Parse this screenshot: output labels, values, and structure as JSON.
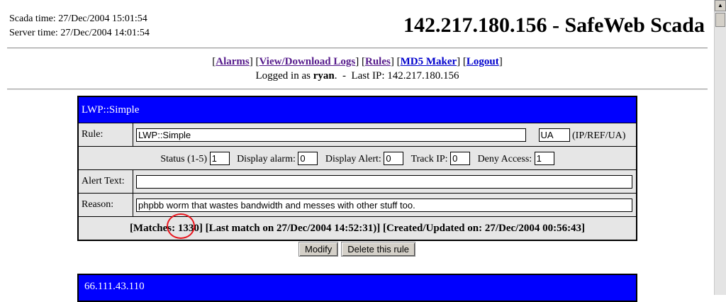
{
  "header": {
    "scada_time_label": "Scada time:",
    "scada_time_value": "27/Dec/2004 15:01:54",
    "server_time_label": "Server time:",
    "server_time_value": "27/Dec/2004 14:01:54",
    "title": "142.217.180.156 - SafeWeb Scada"
  },
  "nav": {
    "alarms": "Alarms",
    "view_logs": "View/Download Logs",
    "rules": "Rules",
    "md5": "MD5 Maker",
    "logout": "Logout"
  },
  "login": {
    "prefix": "Logged in as",
    "user": "ryan",
    "last_ip_label": "Last IP:",
    "last_ip": "142.217.180.156"
  },
  "rule": {
    "header": "LWP::Simple",
    "rule_label": "Rule:",
    "rule_value": "LWP::Simple",
    "type_value": "UA",
    "type_hint": "(IP/REF/UA)",
    "status_label": "Status (1-5)",
    "status_value": "1",
    "display_alarm_label": "Display alarm:",
    "display_alarm_value": "0",
    "display_alert_label": "Display Alert:",
    "display_alert_value": "0",
    "track_ip_label": "Track IP:",
    "track_ip_value": "0",
    "deny_access_label": "Deny Access:",
    "deny_access_value": "1",
    "alert_text_label": "Alert Text:",
    "alert_text_value": "",
    "reason_label": "Reason:",
    "reason_value": "phpbb worm that wastes bandwidth and messes with other stuff too.",
    "matches_label": "[Matches:",
    "matches_value": "1330",
    "matches_rest": "] [Last match on 27/Dec/2004 14:52:31)] [Created/Updated on: 27/Dec/2004 00:56:43]"
  },
  "buttons": {
    "modify": "Modify",
    "delete": "Delete this rule"
  },
  "next_rule": {
    "header": "66.111.43.110"
  },
  "colors": {
    "header_blue": "#0000ff",
    "annotation_red": "#e8141c",
    "row_gray": "#e6e6e6"
  }
}
